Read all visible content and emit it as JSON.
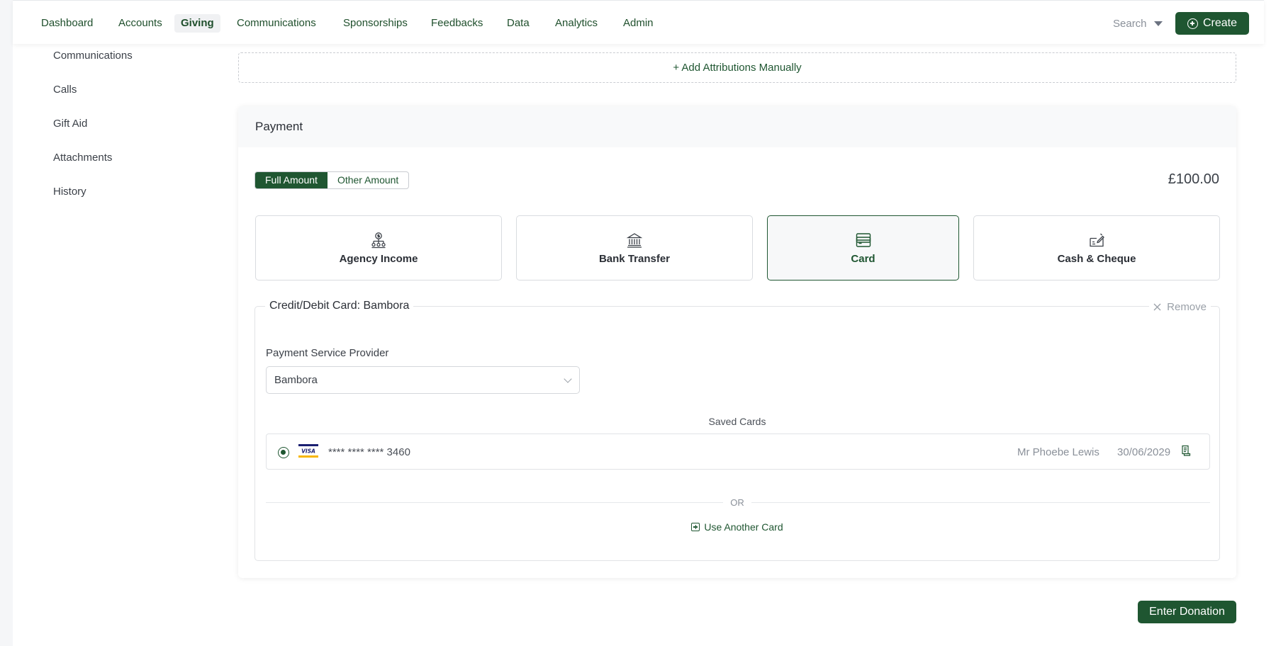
{
  "nav": {
    "items": [
      {
        "label": "Dashboard"
      },
      {
        "label": "Accounts"
      },
      {
        "label": "Giving",
        "active": true
      },
      {
        "label": "Communications"
      },
      {
        "label": "Sponsorships"
      },
      {
        "label": "Feedbacks"
      },
      {
        "label": "Data"
      },
      {
        "label": "Analytics"
      },
      {
        "label": "Admin"
      }
    ],
    "search_label": "Search",
    "create_label": "Create"
  },
  "sidebar": {
    "items": [
      {
        "label": "Communications"
      },
      {
        "label": "Calls"
      },
      {
        "label": "Gift Aid"
      },
      {
        "label": "Attachments"
      },
      {
        "label": "History"
      }
    ]
  },
  "attributions": {
    "add_label": "+ Add Attributions Manually"
  },
  "payment": {
    "title": "Payment",
    "amount_options": [
      {
        "label": "Full Amount",
        "active": true
      },
      {
        "label": "Other Amount",
        "active": false
      }
    ],
    "amount": "£100.00",
    "methods": [
      {
        "label": "Agency Income",
        "icon": "agency-icon"
      },
      {
        "label": "Bank Transfer",
        "icon": "bank-icon"
      },
      {
        "label": "Card",
        "icon": "card-icon",
        "active": true
      },
      {
        "label": "Cash & Cheque",
        "icon": "cheque-icon"
      }
    ],
    "card_section": {
      "legend": "Credit/Debit Card: Bambora",
      "remove_label": "Remove",
      "psp_label": "Payment Service Provider",
      "psp_value": "Bambora",
      "saved_cards_title": "Saved Cards",
      "saved_cards": [
        {
          "brand": "VISA",
          "number": "**** **** **** 3460",
          "holder": "Mr Phoebe Lewis",
          "expiry": "30/06/2029",
          "selected": true
        }
      ],
      "or_label": "OR",
      "use_another_label": "Use Another Card"
    }
  },
  "footer": {
    "enter_donation_label": "Enter Donation"
  },
  "colors": {
    "brand": "#1f5631",
    "border": "#d9dce0",
    "muted": "#8a9099"
  }
}
